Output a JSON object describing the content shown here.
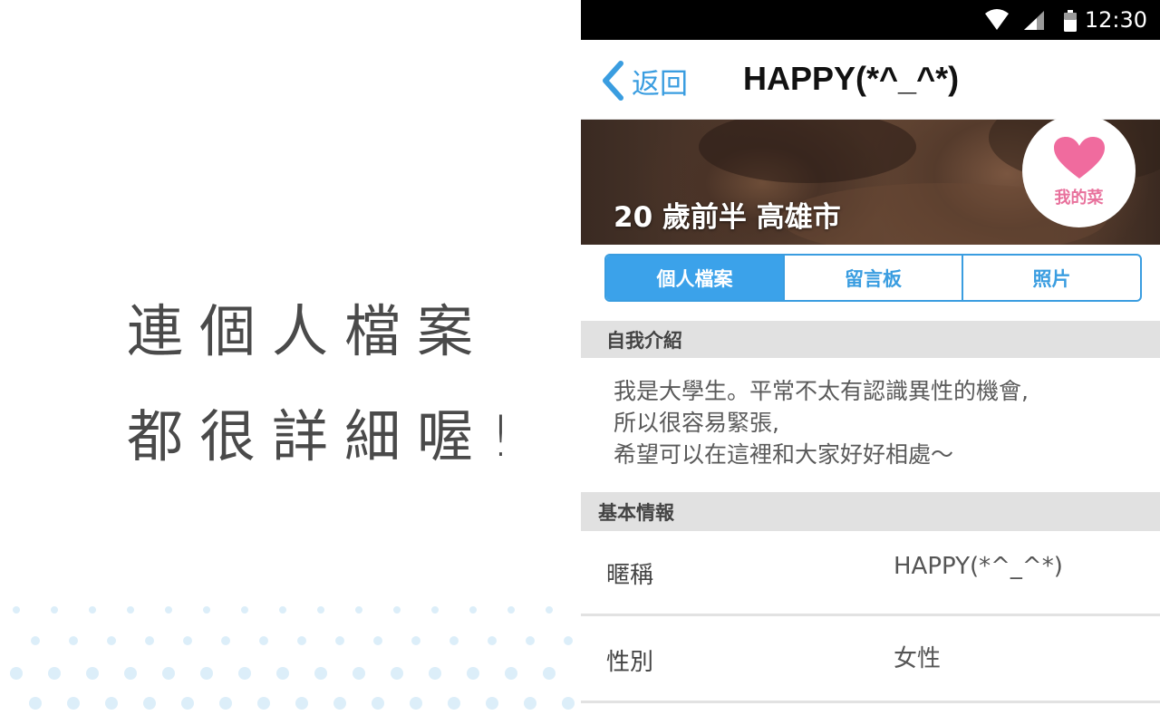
{
  "promo": {
    "headline_line1": "連個人檔案",
    "headline_line2": "都很詳細喔!"
  },
  "status_bar": {
    "time": "12:30",
    "icons": [
      "wifi-icon",
      "signal-icon",
      "battery-icon"
    ]
  },
  "nav": {
    "back_label": "返回",
    "title": "HAPPY(*^_^*)"
  },
  "hero": {
    "age_location": "20 歲前半 高雄市",
    "favorite_label": "我的菜"
  },
  "tabs": [
    {
      "label": "個人檔案",
      "active": true
    },
    {
      "label": "留言板",
      "active": false
    },
    {
      "label": "照片",
      "active": false
    }
  ],
  "intro": {
    "header": "自我介紹",
    "lines": [
      "我是大學生。平常不太有認識異性的機會,",
      "所以很容易緊張,",
      "希望可以在這裡和大家好好相處～"
    ]
  },
  "basic_info": {
    "header": "基本情報",
    "rows": [
      {
        "label": "暱稱",
        "value": "HAPPY(*^_^*)"
      },
      {
        "label": "性別",
        "value": "女性"
      }
    ]
  },
  "colors": {
    "accent": "#3a9de0",
    "tab_active_bg": "#3ba2ea",
    "heart": "#f06b9e",
    "section_bg": "#e1e1e1",
    "dots": "#dceef9"
  }
}
